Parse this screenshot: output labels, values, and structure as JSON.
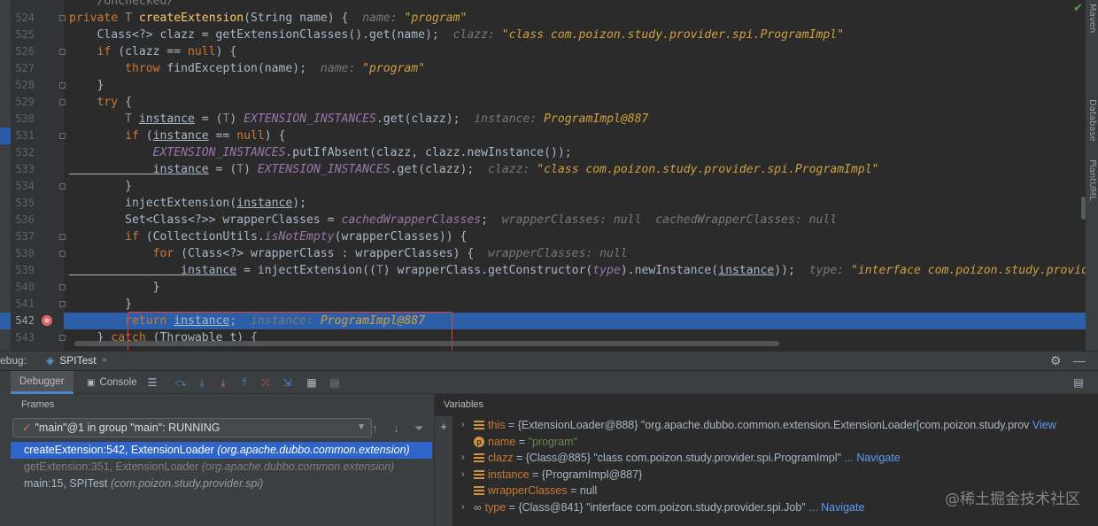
{
  "editor": {
    "top_partial": "/Unchecked/",
    "lines": [
      {
        "n": "524",
        "segs": [
          [
            "k",
            "private "
          ],
          [
            "t",
            "T "
          ],
          [
            "f",
            "createExtension"
          ],
          [
            "p",
            "(String name) {  "
          ],
          [
            "i",
            "name: "
          ],
          [
            "v",
            "\"program\""
          ]
        ]
      },
      {
        "n": "525",
        "segs": [
          [
            "p",
            "    Class<?> clazz = getExtensionClasses().get(name);  "
          ],
          [
            "i",
            "clazz: "
          ],
          [
            "v",
            "\"class com.poizon.study.provider.spi.ProgramImpl\""
          ]
        ]
      },
      {
        "n": "526",
        "segs": [
          [
            "k",
            "    if "
          ],
          [
            "p",
            "(clazz == "
          ],
          [
            "k",
            "null"
          ],
          [
            "p",
            ") {"
          ]
        ]
      },
      {
        "n": "527",
        "segs": [
          [
            "k",
            "        throw "
          ],
          [
            "p",
            "findException(name);  "
          ],
          [
            "i",
            "name: "
          ],
          [
            "v",
            "\"program\""
          ]
        ]
      },
      {
        "n": "528",
        "segs": [
          [
            "p",
            "    }"
          ]
        ]
      },
      {
        "n": "529",
        "segs": [
          [
            "k",
            "    try "
          ],
          [
            "p",
            "{"
          ]
        ]
      },
      {
        "n": "530",
        "segs": [
          [
            "t",
            "        T "
          ],
          [
            "u",
            "instance"
          ],
          [
            "p",
            " = ("
          ],
          [
            "t",
            "T"
          ],
          [
            "p",
            ") "
          ],
          [
            "s",
            "EXTENSION_INSTANCES"
          ],
          [
            "p",
            ".get(clazz);  "
          ],
          [
            "i",
            "instance: "
          ],
          [
            "v",
            "ProgramImpl@887"
          ]
        ]
      },
      {
        "n": "531",
        "segs": [
          [
            "k",
            "        if "
          ],
          [
            "p",
            "("
          ],
          [
            "u",
            "instance"
          ],
          [
            "p",
            " == "
          ],
          [
            "k",
            "null"
          ],
          [
            "p",
            ") {"
          ]
        ]
      },
      {
        "n": "532",
        "segs": [
          [
            "s",
            "            EXTENSION_INSTANCES"
          ],
          [
            "p",
            ".putIfAbsent(clazz, clazz.newInstance());"
          ]
        ]
      },
      {
        "n": "533",
        "segs": [
          [
            "u",
            "            instance"
          ],
          [
            "p",
            " = ("
          ],
          [
            "t",
            "T"
          ],
          [
            "p",
            ") "
          ],
          [
            "s",
            "EXTENSION_INSTANCES"
          ],
          [
            "p",
            ".get(clazz);  "
          ],
          [
            "i",
            "clazz: "
          ],
          [
            "v",
            "\"class com.poizon.study.provider.spi.ProgramImpl\""
          ]
        ]
      },
      {
        "n": "534",
        "segs": [
          [
            "p",
            "        }"
          ]
        ]
      },
      {
        "n": "535",
        "segs": [
          [
            "p",
            "        injectExtension("
          ],
          [
            "u",
            "instance"
          ],
          [
            "p",
            ");"
          ]
        ]
      },
      {
        "n": "536",
        "segs": [
          [
            "p",
            "        Set<Class<?>> wrapperClasses = "
          ],
          [
            "s2",
            "cachedWrapperClasses"
          ],
          [
            "p",
            ";  "
          ],
          [
            "i",
            "wrapperClasses: null  cachedWrapperClasses: null"
          ]
        ]
      },
      {
        "n": "537",
        "segs": [
          [
            "k",
            "        if "
          ],
          [
            "p",
            "(CollectionUtils."
          ],
          [
            "st",
            "isNotEmpty"
          ],
          [
            "p",
            "(wrapperClasses)) {"
          ]
        ]
      },
      {
        "n": "538",
        "segs": [
          [
            "k",
            "            for "
          ],
          [
            "p",
            "(Class<?> wrapperClass : wrapperClasses) {  "
          ],
          [
            "i",
            "wrapperClasses: null"
          ]
        ]
      },
      {
        "n": "539",
        "segs": [
          [
            "u",
            "                instance"
          ],
          [
            "p",
            " = injectExtension(("
          ],
          [
            "t",
            "T"
          ],
          [
            "p",
            ") wrapperClass.getConstructor("
          ],
          [
            "s2",
            "type"
          ],
          [
            "p",
            ").newInstance("
          ],
          [
            "u",
            "instance"
          ],
          [
            "p",
            "));  "
          ],
          [
            "i",
            "type: "
          ],
          [
            "v",
            "\"interface com.poizon.study.provider.spi.Job\""
          ]
        ]
      },
      {
        "n": "540",
        "segs": [
          [
            "p",
            "            }"
          ]
        ]
      },
      {
        "n": "541",
        "segs": [
          [
            "p",
            "        }"
          ]
        ]
      },
      {
        "n": "542",
        "segs": [
          [
            "k",
            "        return "
          ],
          [
            "u",
            "instance"
          ],
          [
            "p",
            ";  "
          ],
          [
            "i",
            "instance: "
          ],
          [
            "v",
            "ProgramImpl@887"
          ]
        ],
        "current": true
      },
      {
        "n": "543",
        "segs": [
          [
            "p",
            "    } "
          ],
          [
            "k",
            "catch "
          ],
          [
            "p",
            "(Throwable t) {"
          ]
        ]
      }
    ],
    "right_tools": [
      "Maven",
      "Database",
      "PlantUML"
    ]
  },
  "debug": {
    "label": "ebug:",
    "session_tab": "SPITest",
    "close": "×",
    "tabs": [
      "Debugger",
      "Console"
    ],
    "frames_title": "Frames",
    "thread": "\"main\"@1 in group \"main\": RUNNING",
    "frames": [
      {
        "method": "createExtension:542, ExtensionLoader",
        "pkg": "(org.apache.dubbo.common.extension)"
      },
      {
        "method": "getExtension:351, ExtensionLoader",
        "pkg": "(org.apache.dubbo.common.extension)"
      },
      {
        "method": "main:15, SPITest",
        "pkg": "(com.poizon.study.provider.spi)"
      }
    ],
    "variables_title": "Variables",
    "variables": [
      {
        "icon": "field",
        "name": "this",
        "value": " = {ExtensionLoader@888} ",
        "str": "\"org.apache.dubbo.common.extension.ExtensionLoader[com.poizon.study.prov",
        "link": "View",
        "expand": true
      },
      {
        "icon": "param",
        "name": "name",
        "value": " = ",
        "str": "\"program\"",
        "link": "",
        "expand": false
      },
      {
        "icon": "field",
        "name": "clazz",
        "value": " = {Class@885} ",
        "str": "\"class com.poizon.study.provider.spi.ProgramImpl\"",
        "link": "Navigate",
        "expand": true
      },
      {
        "icon": "field",
        "name": "instance",
        "value": " = {ProgramImpl@887}",
        "str": "",
        "link": "",
        "expand": true
      },
      {
        "icon": "field",
        "name": "wrapperClasses",
        "value": " = null",
        "str": "",
        "link": "",
        "expand": false
      },
      {
        "icon": "oo",
        "name": "type",
        "value": " = {Class@841} ",
        "str": "\"interface com.poizon.study.provider.spi.Job\"",
        "link": "Navigate",
        "expand": true
      }
    ],
    "watermark": "@稀土掘金技术社区"
  }
}
